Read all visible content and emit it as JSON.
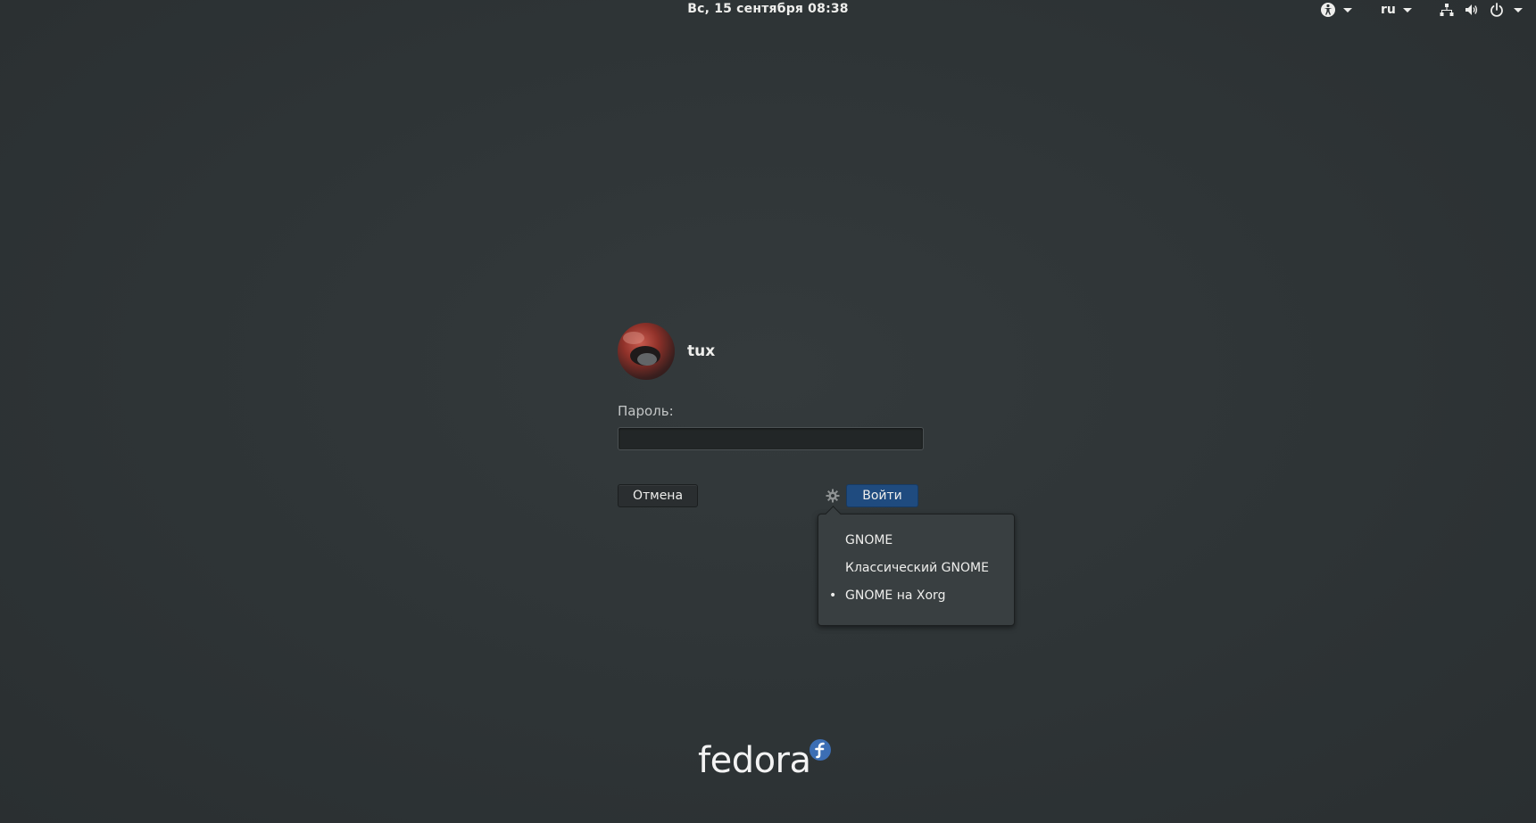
{
  "topbar": {
    "clock": "Вс, 15 сентября  08:38",
    "language": "ru",
    "icons": [
      "accessibility-icon",
      "network-icon",
      "volume-icon",
      "power-icon"
    ]
  },
  "login": {
    "username": "tux",
    "password_label": "Пароль:",
    "password_value": "",
    "cancel_label": "Отмена",
    "signin_label": "Войти"
  },
  "session_menu": {
    "items": [
      {
        "label": "GNOME",
        "selected": false
      },
      {
        "label": "Классический GNOME",
        "selected": false
      },
      {
        "label": "GNOME на Xorg",
        "selected": true
      }
    ]
  },
  "branding": {
    "logo_text": "fedora",
    "accent_color": "#3c6eb4"
  },
  "colors": {
    "background": "#2e3436",
    "signin_button": "#1f4b7f",
    "menu_background": "#393f41"
  }
}
